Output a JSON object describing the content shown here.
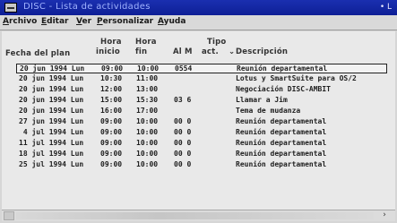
{
  "window": {
    "title": "DISC - Lista de actividades",
    "title_button": "• L"
  },
  "menu": [
    {
      "underline": "A",
      "rest": "rchivo"
    },
    {
      "underline": "E",
      "rest": "ditar"
    },
    {
      "underline": "V",
      "rest": "er"
    },
    {
      "underline": "P",
      "rest": "ersonalizar"
    },
    {
      "underline": "A",
      "rest": "yuda"
    }
  ],
  "headers": {
    "fecha": "Fecha del plan",
    "hora_inicio_1": "Hora",
    "hora_inicio_2": "inicio",
    "hora_fin_1": "Hora",
    "hora_fin_2": "fin",
    "alm": "Al M",
    "tipo_1": "Tipo",
    "tipo_2": "act.",
    "sort_indicator": "⌄",
    "descripcion": "Descripción"
  },
  "rows": [
    {
      "fecha": "20 jun 1994 Lun",
      "inicio": "09:00",
      "fin": "10:00",
      "alm": "0554",
      "desc": "Reunión departamental",
      "selected": true
    },
    {
      "fecha": "20 jun 1994 Lun",
      "inicio": "10:30",
      "fin": "11:00",
      "alm": "",
      "desc": "Lotus y SmartSuite para OS/2",
      "selected": false
    },
    {
      "fecha": "20 jun 1994 Lun",
      "inicio": "12:00",
      "fin": "13:00",
      "alm": "",
      "desc": "Negociación DISC-AMBIT",
      "selected": false
    },
    {
      "fecha": "20 jun 1994 Lun",
      "inicio": "15:00",
      "fin": "15:30",
      "alm": "03 6",
      "desc": "Llamar a Jim",
      "selected": false
    },
    {
      "fecha": "20 jun 1994 Lun",
      "inicio": "16:00",
      "fin": "17:00",
      "alm": "",
      "desc": "Tema de mudanza",
      "selected": false
    },
    {
      "fecha": "27 jun 1994 Lun",
      "inicio": "09:00",
      "fin": "10:00",
      "alm": "00 0",
      "desc": "Reunión departamental",
      "selected": false
    },
    {
      "fecha": " 4 jul 1994 Lun",
      "inicio": "09:00",
      "fin": "10:00",
      "alm": "00 0",
      "desc": "Reunión departamental",
      "selected": false
    },
    {
      "fecha": "11 jul 1994 Lun",
      "inicio": "09:00",
      "fin": "10:00",
      "alm": "00 0",
      "desc": "Reunión departamental",
      "selected": false
    },
    {
      "fecha": "18 jul 1994 Lun",
      "inicio": "09:00",
      "fin": "10:00",
      "alm": "00 0",
      "desc": "Reunión departamental",
      "selected": false
    },
    {
      "fecha": "25 jul 1994 Lun",
      "inicio": "09:00",
      "fin": "10:00",
      "alm": "00 0",
      "desc": "Reunión departamental",
      "selected": false
    }
  ],
  "scrollbar": {
    "right_arrow": "›"
  }
}
